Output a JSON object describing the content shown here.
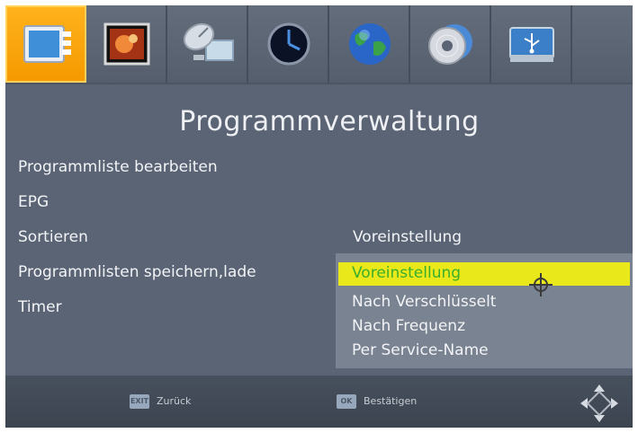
{
  "title": "Programmverwaltung",
  "icons": [
    {
      "name": "programme-icon",
      "active": true
    },
    {
      "name": "picture-icon",
      "active": false
    },
    {
      "name": "satellite-dish-icon",
      "active": false
    },
    {
      "name": "clock-icon",
      "active": false
    },
    {
      "name": "globe-icon",
      "active": false
    },
    {
      "name": "disc-icon",
      "active": false
    },
    {
      "name": "usb-icon",
      "active": false
    }
  ],
  "menu": {
    "items": [
      "Programmliste bearbeiten",
      "EPG",
      "Sortieren",
      "Programmlisten speichern,lade",
      "Timer"
    ]
  },
  "sort": {
    "current_value": "Voreinstellung",
    "options": [
      "Voreinstellung",
      "Nach Verschlüsselt",
      "Nach Frequenz",
      "Per Service-Name"
    ],
    "selected_index": 0
  },
  "footer": {
    "back_key": "EXIT",
    "back_label": "Zurück",
    "ok_key": "OK",
    "ok_label": "Bestätigen"
  },
  "colors": {
    "background": "#5a6474",
    "active_tile": "#f59a00",
    "highlight_bar": "#e8e81a",
    "highlight_text": "#3cae2a"
  }
}
